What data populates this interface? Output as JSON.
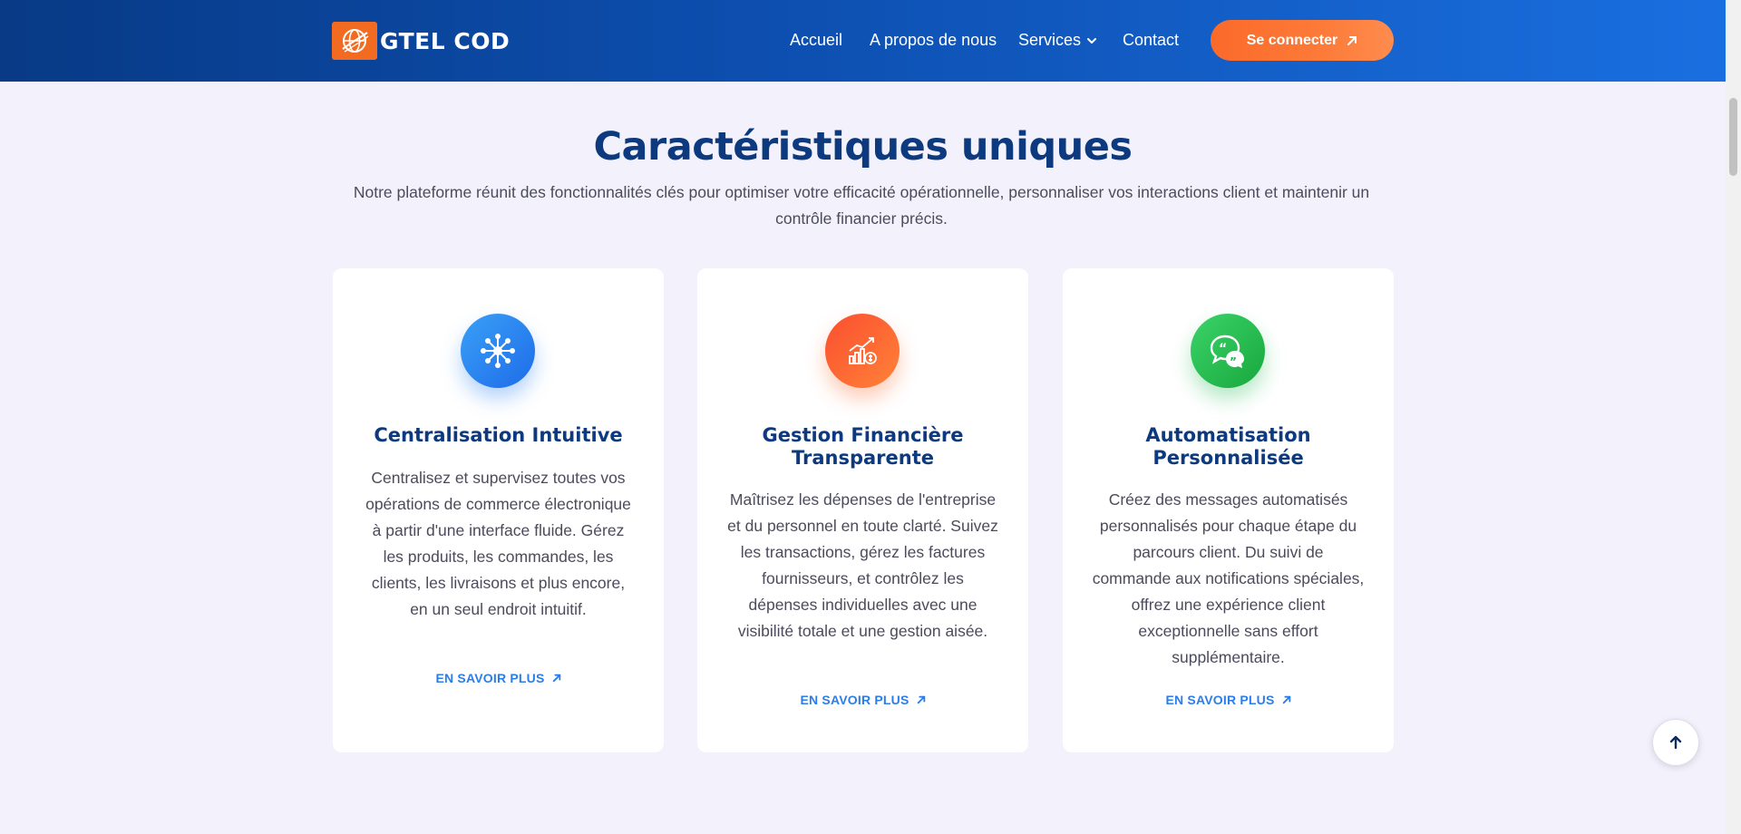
{
  "header": {
    "brand": "GTEL COD",
    "nav": [
      {
        "label": "Accueil"
      },
      {
        "label": "A propos de nous"
      },
      {
        "label": "Services"
      },
      {
        "label": "Contact"
      }
    ],
    "login_label": "Se connecter"
  },
  "section": {
    "title": "Caractéristiques uniques",
    "description": "Notre plateforme réunit des fonctionnalités clés pour optimiser votre efficacité opérationnelle, personnaliser vos interactions client et maintenir un contrôle financier précis."
  },
  "cards": [
    {
      "icon": "network-hub-icon",
      "title": "Centralisation Intuitive",
      "text": "Centralisez et supervisez toutes vos opérations de commerce électronique à partir d'une interface fluide. Gérez les produits, les commandes, les clients, les livraisons et plus encore, en un seul endroit intuitif.",
      "link": "EN SAVOIR PLUS"
    },
    {
      "icon": "finance-growth-icon",
      "title": "Gestion Financière Transparente",
      "text": "Maîtrisez les dépenses de l'entreprise et du personnel en toute clarté. Suivez les transactions, gérez les factures fournisseurs, et contrôlez les dépenses individuelles avec une visibilité totale et une gestion aisée.",
      "link": "EN SAVOIR PLUS"
    },
    {
      "icon": "chat-quote-icon",
      "title": "Automatisation Personnalisée",
      "text": "Créez des messages automatisés personnalisés pour chaque étape du parcours client. Du suivi de commande aux notifications spéciales, offrez une expérience client exceptionnelle sans effort supplémentaire.",
      "link": "EN SAVOIR PLUS"
    }
  ],
  "colors": {
    "header_start": "#083a86",
    "header_end": "#1a6fe0",
    "accent_orange": "#fb6a2a",
    "title_navy": "#0d3a7e",
    "link_blue": "#2b7de9",
    "page_bg": "#f3f2fc"
  }
}
